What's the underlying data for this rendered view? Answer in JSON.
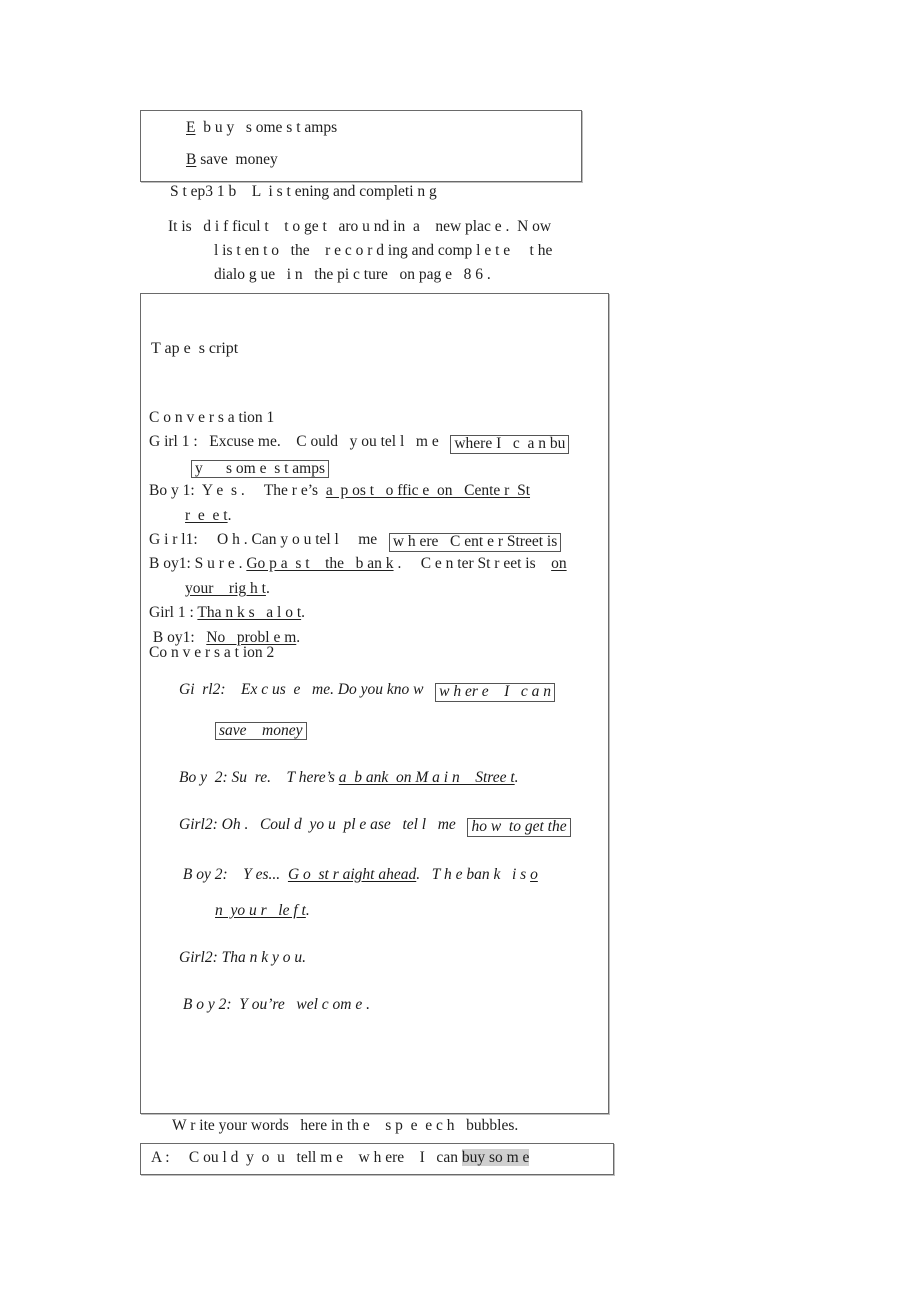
{
  "document": {
    "type": "english-worksheet-page",
    "background_color": "#ffffff",
    "text_color": "#202020",
    "box_border_color": "#6a6a6a",
    "highlight_color": "#cfcfcf"
  },
  "answer_box": {
    "name": "answer-choices-box",
    "rows": [
      {
        "letter": "E",
        "text": "  b u y   s ome s t amps"
      },
      {
        "letter": "B",
        "text": " save  money"
      }
    ]
  },
  "step_heading": "S t ep3 1 b    L  i s t ening and completi n g",
  "intro": {
    "line1": "It is   d i f ficul t    t o ge t   aro u nd in  a    new plac e .  N ow",
    "line2": "l is t en t o   the    r e c o r d ing and comp l e t e     t he",
    "line3": "dialo g ue   i n   the pi c ture   on pag e   8 6 ."
  },
  "tapescript": {
    "title": "T ap e  s cript",
    "conversation1_label": "C o n v e r s a tion 1",
    "conversation2_label": "Co n v e r s a t ion 2",
    "conv1": [
      {
        "speaker": "G irl 1 :",
        "pre": "   Excuse me.    C ould   y ou tel l   m e   ",
        "boxed": "where I   c  a n bu",
        "boxed_cont": "y      s om e  s t amps",
        "post": ""
      },
      {
        "speaker": "Bo y 1:",
        "pre": "  Y e  s .     The r e’s  ",
        "underline": "a  p os t   o ffic e  on   Cente r  St",
        "underline_cont": "r  e  e t",
        "post": "."
      },
      {
        "speaker": "G i r l1:",
        "pre": "     O h . Can y o u tel l     me   ",
        "boxed": "w h ere   C ent e r Street is",
        "post": ""
      },
      {
        "speaker": "B oy1:",
        "pre": " S u r e . ",
        "underline": "Go p a  s t    the   b an k",
        "mid": " .     C e n ter St r eet is    ",
        "underline2": "on",
        "underline2_cont": "your    rig h t",
        "post": "."
      },
      {
        "speaker": "Girl 1 : ",
        "underline": "Tha n k s   a l o t",
        "post": "."
      },
      {
        "speaker": " B oy1:",
        "pre": "   ",
        "underline": "No   probl e m",
        "post": "."
      }
    ],
    "conv2": [
      {
        "speaker": "Gi  rl2:",
        "pre": "    Ex c us  e   me. Do you kno w   ",
        "boxed": "w h er e    I   c a n",
        "boxed_cont": "save    money"
      },
      {
        "speaker": "Bo y  2: ",
        "pre": "Su  re.    T here’s ",
        "underline": "a  b ank  on M a i n    Stree t",
        "post": "."
      },
      {
        "speaker": "Girl2:",
        "pre": " Oh .   Coul d  yo u  pl e ase   tel l   me   ",
        "boxed": "ho w  to get the"
      },
      {
        "speaker": " B oy 2: ",
        "pre": "   Y es...  ",
        "underline": "G o  st r aight ahead",
        "mid": ".   T h e ban k   i s ",
        "underline2": "o",
        "underline2_cont": "n  yo u r   le f t",
        "post": "."
      },
      {
        "speaker": "Girl2: ",
        "pre": "Tha n k y o u."
      },
      {
        "speaker": " B o y 2: ",
        "pre": " Y ou’re   wel c om e ."
      }
    ]
  },
  "write_caption": "W r ite your words   here in th e    s p  e  e c h   bubbles.",
  "bubble_box": {
    "speaker": "A :",
    "text_before": "     C ou l d  y  o  u   tell m e    w h ere    I   can ",
    "highlighted": "buy so m e"
  }
}
